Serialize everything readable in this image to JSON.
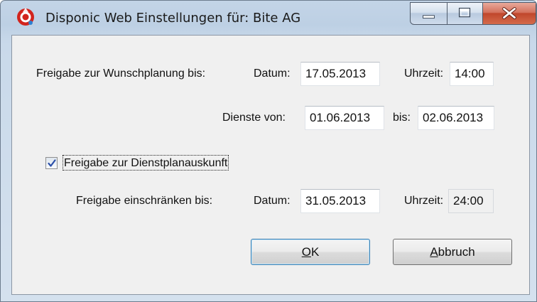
{
  "window": {
    "title": "Disponic Web Einstellungen für: Bite AG"
  },
  "wunschplanung": {
    "label": "Freigabe zur Wunschplanung bis:",
    "datum_label": "Datum:",
    "datum_value": "17.05.2013",
    "uhrzeit_label": "Uhrzeit:",
    "uhrzeit_value": "14:00"
  },
  "dienste": {
    "von_label": "Dienste von:",
    "von_value": "01.06.2013",
    "bis_label": "bis:",
    "bis_value": "02.06.2013"
  },
  "dienstplanauskunft": {
    "checkbox_label": "Freigabe zur Dienstplanauskunft",
    "checked": true
  },
  "einschraenken": {
    "label": "Freigabe einschränken bis:",
    "datum_label": "Datum:",
    "datum_value": "31.05.2013",
    "uhrzeit_label": "Uhrzeit:",
    "uhrzeit_value": "24:00"
  },
  "buttons": {
    "ok_mnemonic": "O",
    "ok_rest": "K",
    "cancel_mnemonic": "A",
    "cancel_rest": "bbruch"
  },
  "icons": {
    "app": "disponic-app-icon",
    "minimize": "minimize-icon",
    "maximize": "maximize-icon",
    "close": "close-icon",
    "check": "checkmark-icon"
  },
  "colors": {
    "close_button": "#c0472c",
    "checkmark": "#2b4fa8",
    "app_icon": "#d2241d"
  }
}
